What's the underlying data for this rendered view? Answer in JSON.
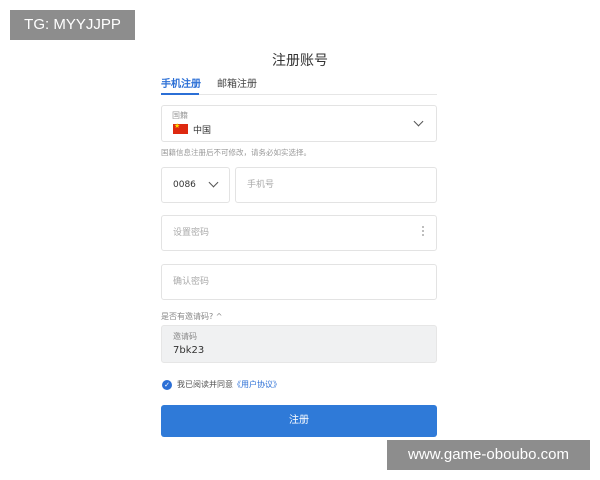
{
  "watermarks": {
    "top_left": "TG: MYYJJPP",
    "bottom_right": "www.game-oboubo.com"
  },
  "page": {
    "title": "注册账号"
  },
  "tabs": [
    {
      "label": "手机注册",
      "active": true
    },
    {
      "label": "邮箱注册",
      "active": false
    }
  ],
  "country": {
    "label": "国籍",
    "value": "中国",
    "flag_color": "#de2910",
    "hint": "国籍信息注册后不可修改，请务必如实选择。"
  },
  "phone": {
    "code": "0086",
    "placeholder": "手机号"
  },
  "password": {
    "placeholder": "设置密码"
  },
  "confirm_password": {
    "placeholder": "确认密码"
  },
  "invite": {
    "question": "是否有邀请码? ^",
    "label": "邀请码",
    "value": "7bk23"
  },
  "agreement": {
    "text": "我已阅读并同意",
    "link": "《用户协议》"
  },
  "submit": {
    "label": "注册",
    "color": "#2f7ad8"
  },
  "colors": {
    "accent": "#2b6fd6"
  }
}
